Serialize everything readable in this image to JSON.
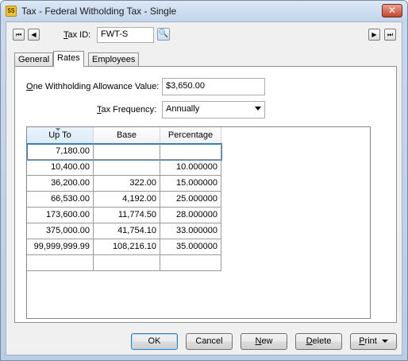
{
  "window": {
    "title": "Tax - Federal Witholding Tax - Single",
    "app_icon_glyph": "$$",
    "close_glyph": "✕"
  },
  "nav": {
    "first_glyph": "⏮",
    "prev_glyph": "◀",
    "next_glyph": "▶",
    "last_glyph": "⏭"
  },
  "tax_id": {
    "label_mnemonic": "T",
    "label_rest": "ax ID:",
    "value": "FWT-S",
    "lookup_glyph": "🔍"
  },
  "tabs": [
    {
      "label": "General"
    },
    {
      "label": "Rates"
    },
    {
      "label": "Employees"
    }
  ],
  "allowance": {
    "label_mnemonic": "O",
    "label_rest": "ne Withholding Allowance Value:",
    "value": "$3,650.00"
  },
  "frequency": {
    "label_mnemonic": "T",
    "label_rest": "ax Frequency:",
    "value": "Annually"
  },
  "grid": {
    "headers": [
      "Up To",
      "Base",
      "Percentage"
    ],
    "rows": [
      [
        "7,180.00",
        "",
        ""
      ],
      [
        "10,400.00",
        "",
        "10.000000"
      ],
      [
        "36,200.00",
        "322.00",
        "15.000000"
      ],
      [
        "66,530.00",
        "4,192.00",
        "25.000000"
      ],
      [
        "173,600.00",
        "11,774.50",
        "28.000000"
      ],
      [
        "375,000.00",
        "41,754.10",
        "33.000000"
      ],
      [
        "99,999,999.99",
        "108,216.10",
        "35.000000"
      ],
      [
        "",
        "",
        ""
      ]
    ]
  },
  "buttons": {
    "ok": "OK",
    "cancel": "Cancel",
    "new_mnemonic": "N",
    "new_rest": "ew",
    "delete_mnemonic": "D",
    "delete_rest": "elete",
    "print_mnemonic": "P",
    "print_rest": "rint"
  },
  "colors": {
    "selection_outline": "#3c7fb1",
    "titlebar": "#c2d5ec",
    "close_button": "#c7452c"
  }
}
